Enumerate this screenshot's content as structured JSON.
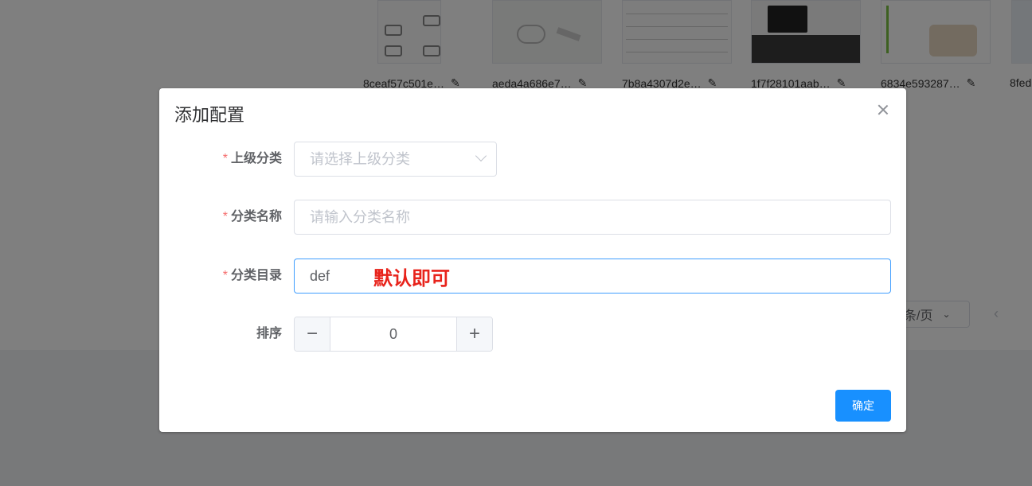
{
  "background": {
    "thumbnails": [
      {
        "caption": "8ceaf57c501e…"
      },
      {
        "caption": "aeda4a686e7…"
      },
      {
        "caption": "7b8a4307d2e…"
      },
      {
        "caption": "1f7f28101aab…"
      },
      {
        "caption": "6834e593287…"
      },
      {
        "caption": "8fed"
      }
    ],
    "edit_icon": "✎",
    "pager_size_label": "条/页",
    "prev_icon": "‹"
  },
  "dialog": {
    "title": "添加配置",
    "fields": {
      "parent_category": {
        "required_mark": "*",
        "label": "上级分类",
        "placeholder": "请选择上级分类"
      },
      "category_name": {
        "required_mark": "*",
        "label": "分类名称",
        "placeholder": "请输入分类名称"
      },
      "category_dir": {
        "required_mark": "*",
        "label": "分类目录",
        "value": "def",
        "annotation": "默认即可"
      },
      "sort": {
        "label": "排序",
        "value": "0",
        "minus": "−",
        "plus": "+"
      }
    },
    "confirm_label": "确定"
  },
  "colors": {
    "primary": "#1890ff",
    "required": "#f56c6c",
    "annotation": "#e8231b",
    "focus_border": "#409eff"
  }
}
